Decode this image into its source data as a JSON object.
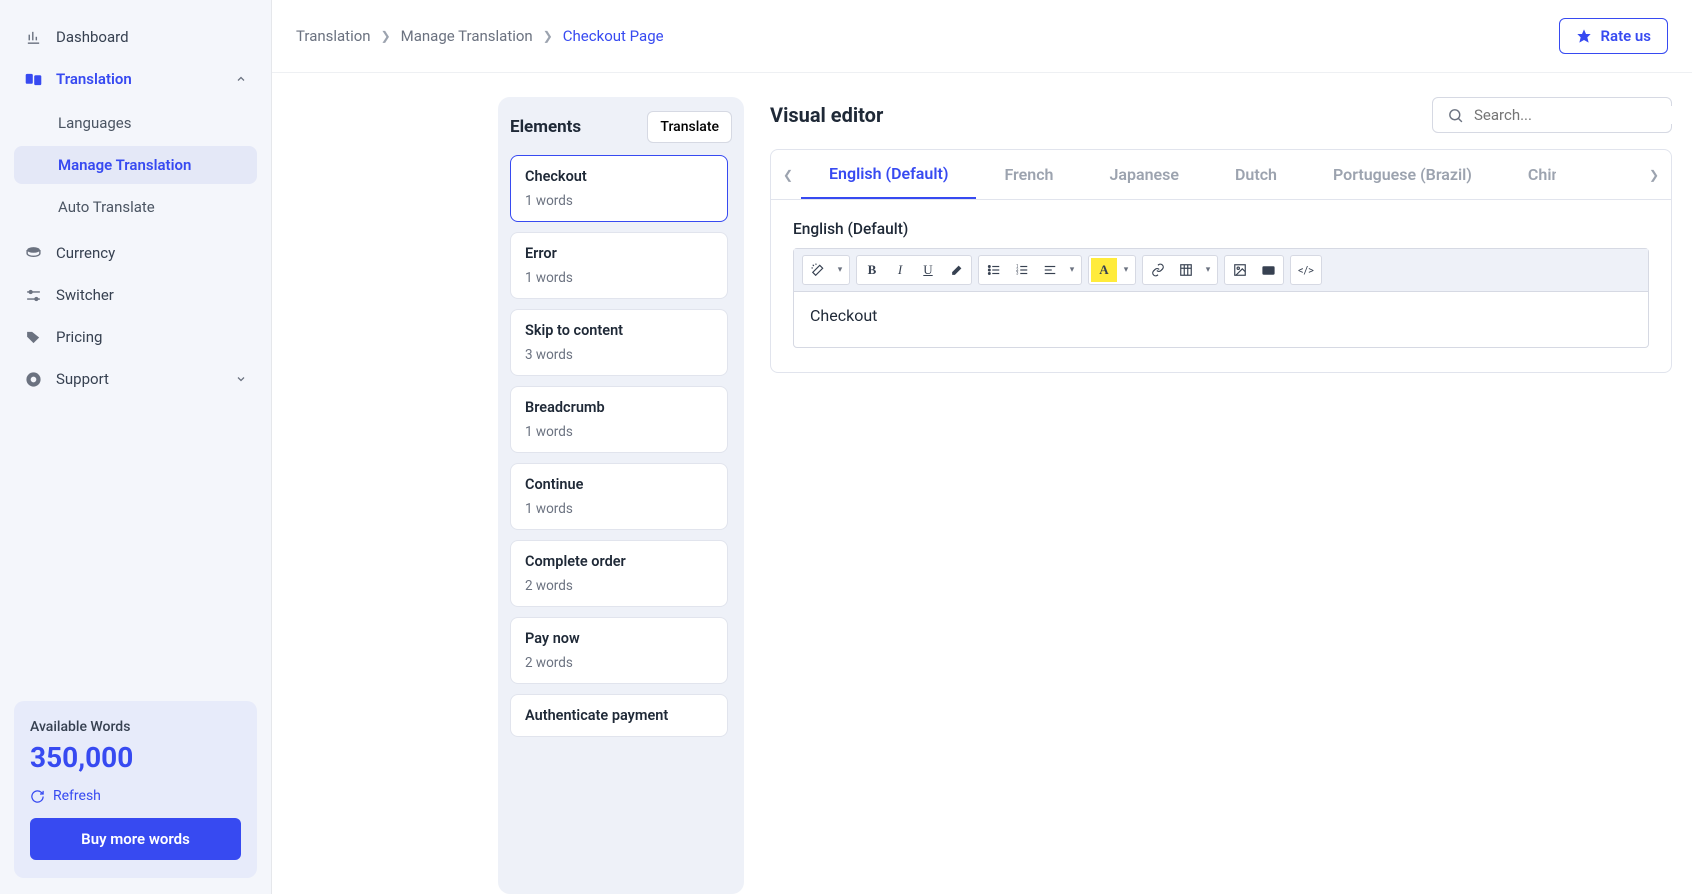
{
  "sidebar": {
    "items": [
      {
        "label": "Dashboard"
      },
      {
        "label": "Translation"
      },
      {
        "label": "Currency"
      },
      {
        "label": "Switcher"
      },
      {
        "label": "Pricing"
      },
      {
        "label": "Support"
      }
    ],
    "translation_sub": [
      {
        "label": "Languages"
      },
      {
        "label": "Manage Translation"
      },
      {
        "label": "Auto Translate"
      }
    ]
  },
  "words_card": {
    "label": "Available Words",
    "count": "350,000",
    "refresh": "Refresh",
    "buy": "Buy more words"
  },
  "breadcrumb": {
    "items": [
      "Translation",
      "Manage Translation",
      "Checkout Page"
    ]
  },
  "rate_button": "Rate us",
  "elements_panel": {
    "title": "Elements",
    "translate_btn": "Translate",
    "items": [
      {
        "title": "Checkout",
        "meta": "1 words"
      },
      {
        "title": "Error",
        "meta": "1 words"
      },
      {
        "title": "Skip to content",
        "meta": "3 words"
      },
      {
        "title": "Breadcrumb",
        "meta": "1 words"
      },
      {
        "title": "Continue",
        "meta": "1 words"
      },
      {
        "title": "Complete order",
        "meta": "2 words"
      },
      {
        "title": "Pay now",
        "meta": "2 words"
      },
      {
        "title": "Authenticate payment",
        "meta": ""
      }
    ]
  },
  "editor": {
    "title": "Visual editor",
    "search_placeholder": "Search...",
    "tabs": [
      "English (Default)",
      "French",
      "Japanese",
      "Dutch",
      "Portuguese (Brazil)",
      "Chinese"
    ],
    "current_lang_label": "English (Default)",
    "content": "Checkout"
  }
}
